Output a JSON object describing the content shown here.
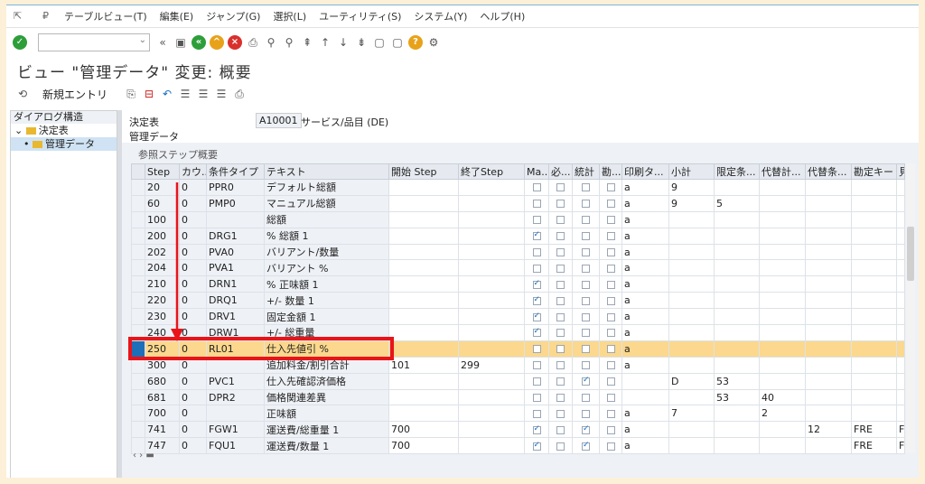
{
  "menu": [
    "テーブルビュー(T)",
    "編集(E)",
    "ジャンプ(G)",
    "選択(L)",
    "ユーティリティ(S)",
    "システム(Y)",
    "ヘルプ(H)"
  ],
  "title": "ビュー \"管理データ\" 変更: 概要",
  "new_entry": "新規エントリ",
  "nav": {
    "header": "ダイアログ構造",
    "item1": "決定表",
    "item2": "管理データ"
  },
  "decision": {
    "label": "決定表",
    "code": "A10001",
    "desc": "サービス/品目 (DE)"
  },
  "section": "管理データ",
  "group_title": "参照ステップ概要",
  "columns": [
    "Step",
    "カウ...",
    "条件タイプ",
    "テキスト",
    "開始 Step",
    "終了Step",
    "Ma...",
    "必...",
    "統計",
    "勘...",
    "印刷タ...",
    "小計",
    "限定条...",
    "代替計...",
    "代替条...",
    "勘定キー",
    "見"
  ],
  "rows": [
    [
      "20",
      "0",
      "PPR0",
      "デフォルト総額",
      "",
      "",
      0,
      0,
      0,
      0,
      "a",
      "9",
      "",
      "",
      "",
      "",
      ""
    ],
    [
      "60",
      "0",
      "PMP0",
      "マニュアル総額",
      "",
      "",
      0,
      0,
      0,
      0,
      "a",
      "9",
      "5",
      "",
      "",
      "",
      ""
    ],
    [
      "100",
      "0",
      "",
      "総額",
      "",
      "",
      0,
      0,
      0,
      0,
      "a",
      "",
      "",
      "",
      "",
      "",
      ""
    ],
    [
      "200",
      "0",
      "DRG1",
      "% 総額 1",
      "",
      "",
      1,
      0,
      0,
      0,
      "a",
      "",
      "",
      "",
      "",
      "",
      ""
    ],
    [
      "202",
      "0",
      "PVA0",
      "バリアント/数量",
      "",
      "",
      0,
      0,
      0,
      0,
      "a",
      "",
      "",
      "",
      "",
      "",
      ""
    ],
    [
      "204",
      "0",
      "PVA1",
      "バリアント %",
      "",
      "",
      0,
      0,
      0,
      0,
      "a",
      "",
      "",
      "",
      "",
      "",
      ""
    ],
    [
      "210",
      "0",
      "DRN1",
      "% 正味額 1",
      "",
      "",
      1,
      0,
      0,
      0,
      "a",
      "",
      "",
      "",
      "",
      "",
      ""
    ],
    [
      "220",
      "0",
      "DRQ1",
      "+/- 数量 1",
      "",
      "",
      1,
      0,
      0,
      0,
      "a",
      "",
      "",
      "",
      "",
      "",
      ""
    ],
    [
      "230",
      "0",
      "DRV1",
      "固定金額 1",
      "",
      "",
      1,
      0,
      0,
      0,
      "a",
      "",
      "",
      "",
      "",
      "",
      ""
    ],
    [
      "240",
      "0",
      "DRW1",
      "+/- 総重量",
      "",
      "",
      1,
      0,
      0,
      0,
      "a",
      "",
      "",
      "",
      "",
      "",
      ""
    ],
    [
      "250",
      "0",
      "RL01",
      "仕入先値引 %",
      "",
      "",
      0,
      0,
      0,
      0,
      "a",
      "",
      "",
      "",
      "",
      "",
      ""
    ],
    [
      "300",
      "0",
      "",
      "追加料金/割引合計",
      "101",
      "299",
      0,
      0,
      0,
      0,
      "a",
      "",
      "",
      "",
      "",
      "",
      ""
    ],
    [
      "680",
      "0",
      "PVC1",
      "仕入先確認済価格",
      "",
      "",
      0,
      0,
      1,
      0,
      "",
      "D",
      "53",
      "",
      "",
      "",
      ""
    ],
    [
      "681",
      "0",
      "DPR2",
      "価格関連差異",
      "",
      "",
      0,
      0,
      0,
      0,
      "",
      "",
      "53",
      "40",
      "",
      "",
      ""
    ],
    [
      "700",
      "0",
      "",
      "正味額",
      "",
      "",
      0,
      0,
      0,
      0,
      "a",
      "7",
      "",
      "2",
      "",
      "",
      ""
    ],
    [
      "741",
      "0",
      "FGW1",
      "運送費/総重量 1",
      "700",
      "",
      1,
      0,
      1,
      0,
      "a",
      "",
      "",
      "",
      "12",
      "FRE",
      "FR"
    ],
    [
      "747",
      "0",
      "FQU1",
      "運送費/数量 1",
      "700",
      "",
      1,
      0,
      1,
      0,
      "a",
      "",
      "",
      "",
      "",
      "FRE",
      "FR"
    ]
  ],
  "highlight_row": 10,
  "accent": "#e8141a"
}
